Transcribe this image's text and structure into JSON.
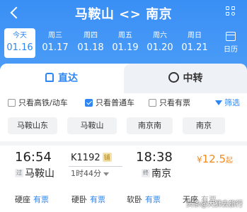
{
  "nav": {
    "title": "马鞍山 <> 南京"
  },
  "dates": [
    {
      "weekday": "今天",
      "date": "01.16",
      "active": true
    },
    {
      "weekday": "周三",
      "date": "01.17",
      "active": false
    },
    {
      "weekday": "周四",
      "date": "01.18",
      "active": false
    },
    {
      "weekday": "周五",
      "date": "01.19",
      "active": false
    },
    {
      "weekday": "周六",
      "date": "01.20",
      "active": false
    },
    {
      "weekday": "周日",
      "date": "01.21",
      "active": false
    }
  ],
  "calendar_label": "日历",
  "tabs": {
    "direct": "直达",
    "transfer": "中转"
  },
  "filters": {
    "high_speed": "只看高铁/动车",
    "normal": "只看普通车",
    "available": "只看有票",
    "filter_button": "筛选"
  },
  "stations": [
    "马鞍山东",
    "马鞍山",
    "南京南",
    "南京"
  ],
  "trip": {
    "depart_time": "16:54",
    "depart_tag": "过",
    "depart_station": "马鞍山",
    "train_no": "K1192",
    "train_tag": "铺",
    "duration": "1时44分",
    "arrive_time": "18:38",
    "arrive_tag": "终",
    "arrive_station": "南京",
    "price_symbol": "¥",
    "price": "12.5",
    "price_suffix": "起",
    "seats": [
      {
        "name": "硬座",
        "status": "有票"
      },
      {
        "name": "硬卧",
        "status": "有票"
      },
      {
        "name": "软卧",
        "status": "有票"
      },
      {
        "name": "无座",
        "status": "有票"
      }
    ]
  },
  "watermark": "头条@大狮去旅行",
  "colors": {
    "primary": "#2e86f2",
    "price": "#f08a1f",
    "header_bg": "#3a8ff5"
  }
}
